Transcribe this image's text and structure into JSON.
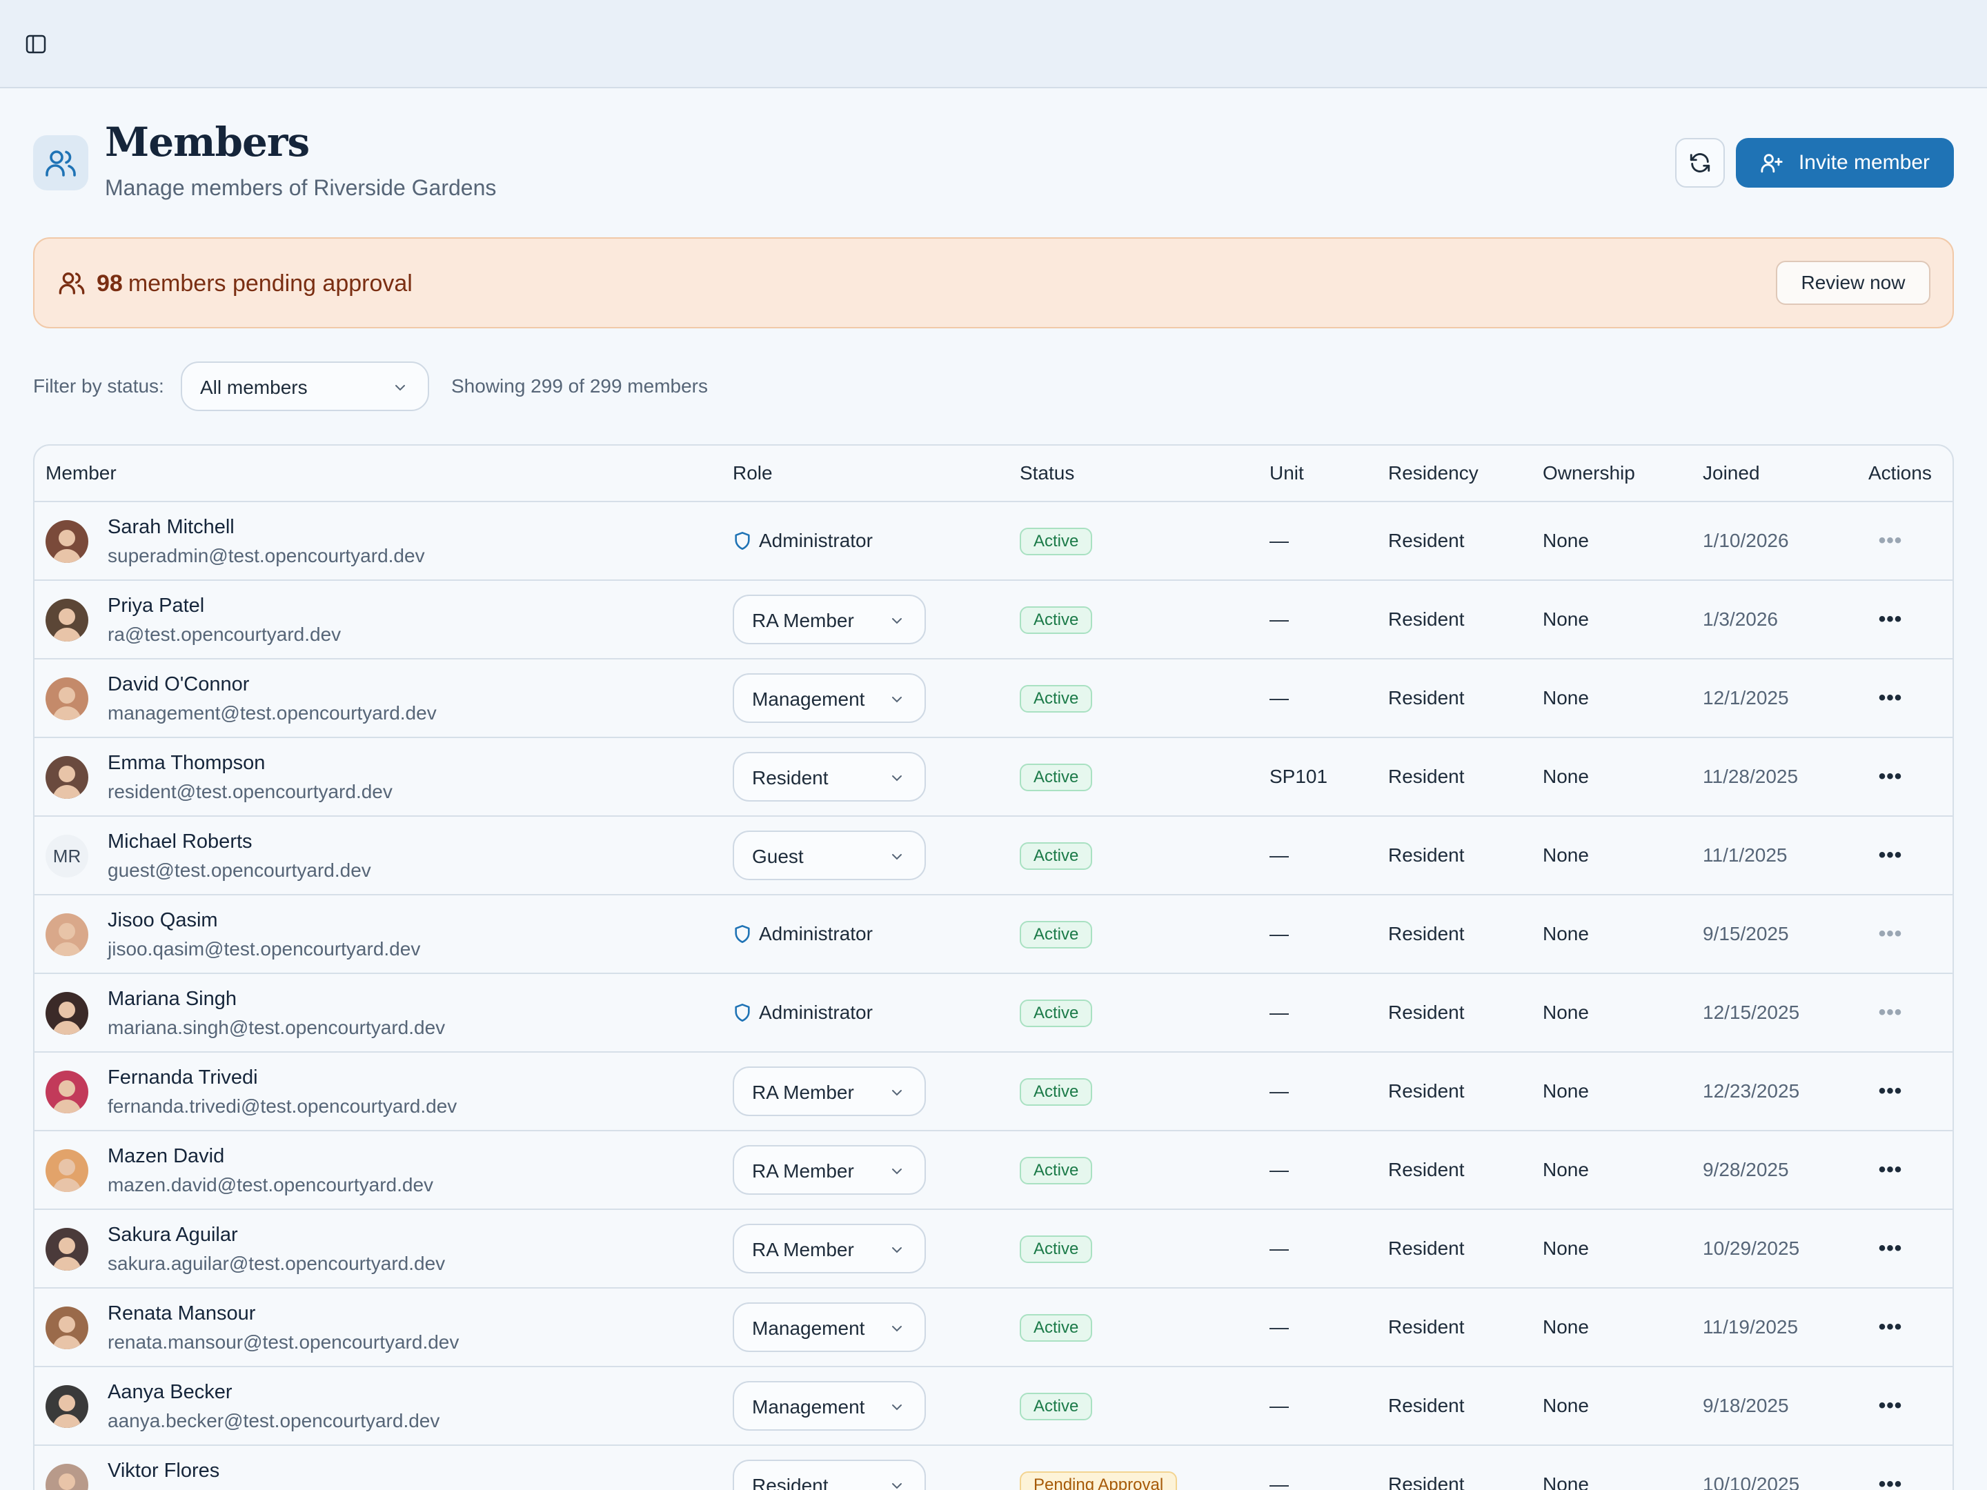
{
  "header": {
    "title": "Members",
    "subtitle": "Manage members of Riverside Gardens",
    "invite_label": "Invite member"
  },
  "banner": {
    "count": "98",
    "text": "members pending approval",
    "review_label": "Review now"
  },
  "filter": {
    "label": "Filter by status:",
    "selected": "All members",
    "showing": "Showing 299 of 299 members"
  },
  "table": {
    "columns": {
      "member": "Member",
      "role": "Role",
      "status": "Status",
      "unit": "Unit",
      "residency": "Residency",
      "ownership": "Ownership",
      "joined": "Joined",
      "actions": "Actions"
    },
    "rows": [
      {
        "name": "Sarah Mitchell",
        "email": "superadmin@test.opencourtyard.dev",
        "role": "Administrator",
        "role_editable": false,
        "status": "Active",
        "unit": "—",
        "residency": "Resident",
        "ownership": "None",
        "joined": "1/10/2026",
        "actions": "•••"
      },
      {
        "name": "Priya Patel",
        "email": "ra@test.opencourtyard.dev",
        "role": "RA Member",
        "role_editable": true,
        "status": "Active",
        "unit": "—",
        "residency": "Resident",
        "ownership": "None",
        "joined": "1/3/2026",
        "actions": "•••"
      },
      {
        "name": "David O'Connor",
        "email": "management@test.opencourtyard.dev",
        "role": "Management",
        "role_editable": true,
        "status": "Active",
        "unit": "—",
        "residency": "Resident",
        "ownership": "None",
        "joined": "12/1/2025",
        "actions": "•••"
      },
      {
        "name": "Emma Thompson",
        "email": "resident@test.opencourtyard.dev",
        "role": "Resident",
        "role_editable": true,
        "status": "Active",
        "unit": "SP101",
        "residency": "Resident",
        "ownership": "None",
        "joined": "11/28/2025",
        "actions": "•••"
      },
      {
        "name": "Michael Roberts",
        "email": "guest@test.opencourtyard.dev",
        "role": "Guest",
        "role_editable": true,
        "status": "Active",
        "unit": "—",
        "residency": "Resident",
        "ownership": "None",
        "joined": "11/1/2025",
        "initials": "MR",
        "actions": "•••"
      },
      {
        "name": "Jisoo Qasim",
        "email": "jisoo.qasim@test.opencourtyard.dev",
        "role": "Administrator",
        "role_editable": false,
        "status": "Active",
        "unit": "—",
        "residency": "Resident",
        "ownership": "None",
        "joined": "9/15/2025",
        "actions": "•••"
      },
      {
        "name": "Mariana Singh",
        "email": "mariana.singh@test.opencourtyard.dev",
        "role": "Administrator",
        "role_editable": false,
        "status": "Active",
        "unit": "—",
        "residency": "Resident",
        "ownership": "None",
        "joined": "12/15/2025",
        "actions": "•••"
      },
      {
        "name": "Fernanda Trivedi",
        "email": "fernanda.trivedi@test.opencourtyard.dev",
        "role": "RA Member",
        "role_editable": true,
        "status": "Active",
        "unit": "—",
        "residency": "Resident",
        "ownership": "None",
        "joined": "12/23/2025",
        "actions": "•••"
      },
      {
        "name": "Mazen David",
        "email": "mazen.david@test.opencourtyard.dev",
        "role": "RA Member",
        "role_editable": true,
        "status": "Active",
        "unit": "—",
        "residency": "Resident",
        "ownership": "None",
        "joined": "9/28/2025",
        "actions": "•••"
      },
      {
        "name": "Sakura Aguilar",
        "email": "sakura.aguilar@test.opencourtyard.dev",
        "role": "RA Member",
        "role_editable": true,
        "status": "Active",
        "unit": "—",
        "residency": "Resident",
        "ownership": "None",
        "joined": "10/29/2025",
        "actions": "•••"
      },
      {
        "name": "Renata Mansour",
        "email": "renata.mansour@test.opencourtyard.dev",
        "role": "Management",
        "role_editable": true,
        "status": "Active",
        "unit": "—",
        "residency": "Resident",
        "ownership": "None",
        "joined": "11/19/2025",
        "actions": "•••"
      },
      {
        "name": "Aanya Becker",
        "email": "aanya.becker@test.opencourtyard.dev",
        "role": "Management",
        "role_editable": true,
        "status": "Active",
        "unit": "—",
        "residency": "Resident",
        "ownership": "None",
        "joined": "9/18/2025",
        "actions": "•••"
      },
      {
        "name": "Viktor Flores",
        "email": "",
        "role": "Resident",
        "role_editable": true,
        "status": "Pending Approval",
        "unit": "—",
        "residency": "Resident",
        "ownership": "None",
        "joined": "10/10/2025",
        "actions": "•••"
      }
    ]
  },
  "colors": {
    "primary": "#1f73b5",
    "banner_bg": "#fbe9dc",
    "active": "#1b7a48",
    "pending": "#a65a08"
  },
  "icons": [
    "sidebar-toggle-icon",
    "users-icon",
    "refresh-icon",
    "user-plus-icon",
    "chevron-down-icon",
    "shield-icon",
    "more-horizontal-icon"
  ]
}
